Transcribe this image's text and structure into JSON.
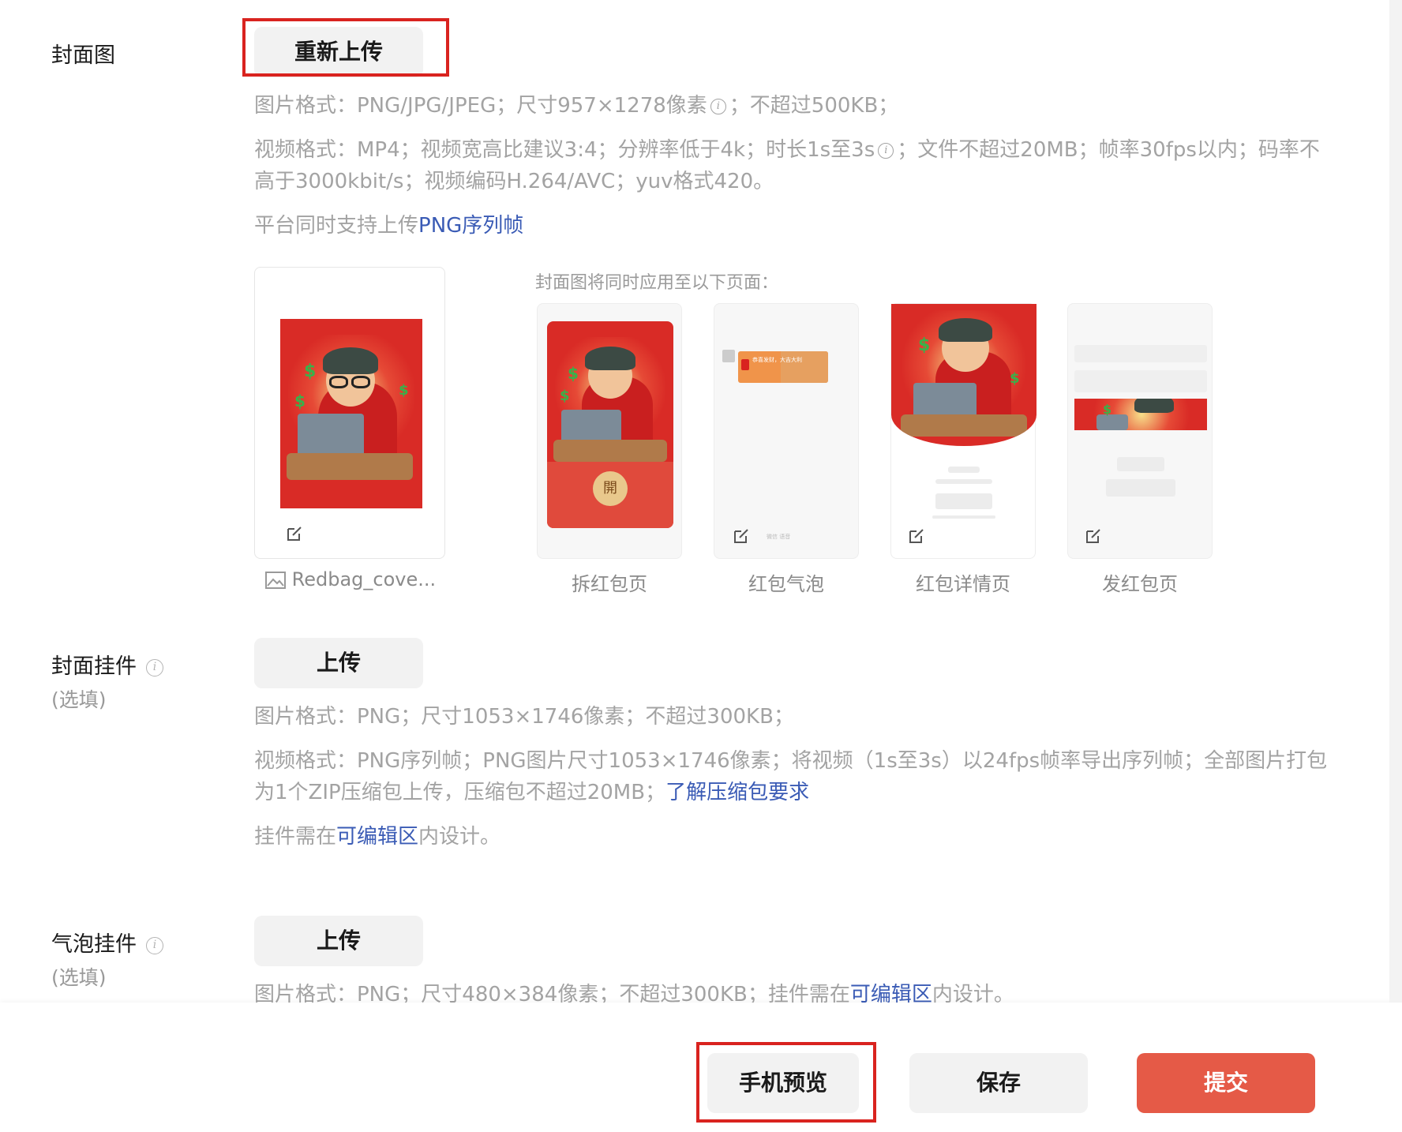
{
  "cover": {
    "label": "封面图",
    "reupload_button": "重新上传",
    "hint_image_prefix": "图片格式：PNG/JPG/JPEG；尺寸957×1278像素",
    "hint_image_suffix": "；不超过500KB；",
    "hint_video_prefix": "视频格式：MP4；视频宽高比建议3:4；分辨率低于4k；时长1s至3s",
    "hint_video_suffix": "；文件不超过20MB；帧率30fps以内；码率不高于3000kbit/s；视频编码H.264/AVC；yuv格式420。",
    "hint_png_prefix": "平台同时支持上传",
    "hint_png_link": "PNG序列帧",
    "apply_title": "封面图将同时应用至以下页面：",
    "file_name": "Redbag_cove...",
    "previews": [
      {
        "caption": "拆红包页"
      },
      {
        "caption": "红包气泡"
      },
      {
        "caption": "红包详情页"
      },
      {
        "caption": "发红包页"
      }
    ],
    "open_label": "開",
    "bubble_text": "恭喜发财，大吉大利",
    "bubble_input": "微信 语音"
  },
  "cover_pendant": {
    "label": "封面挂件",
    "optional": "(选填)",
    "upload_button": "上传",
    "hint_image": "图片格式：PNG；尺寸1053×1746像素；不超过300KB；",
    "hint_video_prefix": "视频格式：PNG序列帧；PNG图片尺寸1053×1746像素；将视频（1s至3s）以24fps帧率导出序列帧；全部图片打包为1个ZIP压缩包上传，压缩包不超过20MB；",
    "hint_video_link": "了解压缩包要求",
    "hint_edit_prefix": "挂件需在",
    "hint_edit_link": "可编辑区",
    "hint_edit_suffix": "内设计。"
  },
  "bubble_pendant": {
    "label": "气泡挂件",
    "optional": "(选填)",
    "upload_button": "上传",
    "hint_prefix": "图片格式：PNG；尺寸480×384像素；不超过300KB；挂件需在",
    "hint_link": "可编辑区",
    "hint_suffix": "内设计。"
  },
  "footer": {
    "preview_button": "手机预览",
    "save_button": "保存",
    "submit_button": "提交"
  },
  "colors": {
    "accent_red": "#e55a47",
    "highlight_border": "#d9231f",
    "link_blue": "#3a5bb5",
    "hint_gray": "#a3a3a3"
  }
}
